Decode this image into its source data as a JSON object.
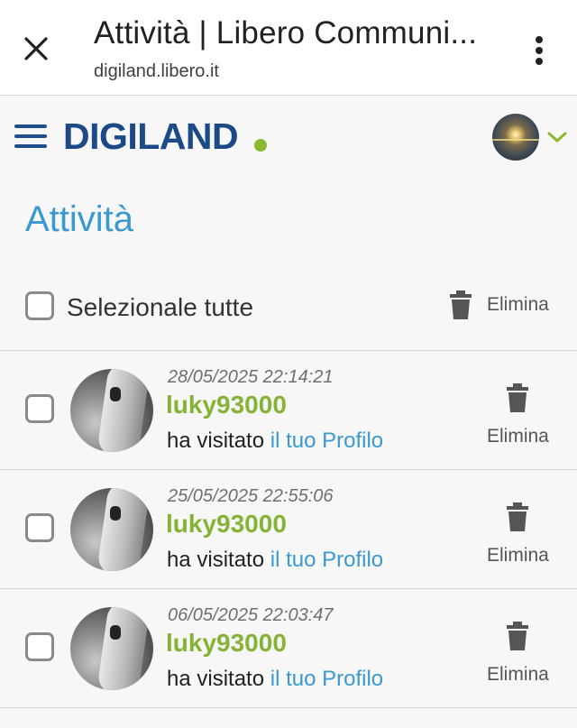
{
  "browser": {
    "tab_title": "Attività | Libero Communi...",
    "url": "digiland.libero.it"
  },
  "header": {
    "logo_text": "DIGILAND",
    "brand_color": "#1b4a86",
    "accent_color": "#8ab82e"
  },
  "page": {
    "title": "Attività",
    "select_all_label": "Selezionale tutte",
    "delete_label": "Elimina"
  },
  "notifications": [
    {
      "timestamp": "28/05/2025 22:14:21",
      "user": "luky93000",
      "action": "ha visitato",
      "link": "il tuo Profilo",
      "delete_label": "Elimina"
    },
    {
      "timestamp": "25/05/2025 22:55:06",
      "user": "luky93000",
      "action": "ha visitato",
      "link": "il tuo Profilo",
      "delete_label": "Elimina"
    },
    {
      "timestamp": "06/05/2025 22:03:47",
      "user": "luky93000",
      "action": "ha visitato",
      "link": "il tuo Profilo",
      "delete_label": "Elimina"
    }
  ],
  "icons": [
    "close-icon",
    "more-vert-icon",
    "hamburger-menu-icon",
    "chevron-down-icon",
    "trash-icon",
    "checkbox-icon"
  ]
}
